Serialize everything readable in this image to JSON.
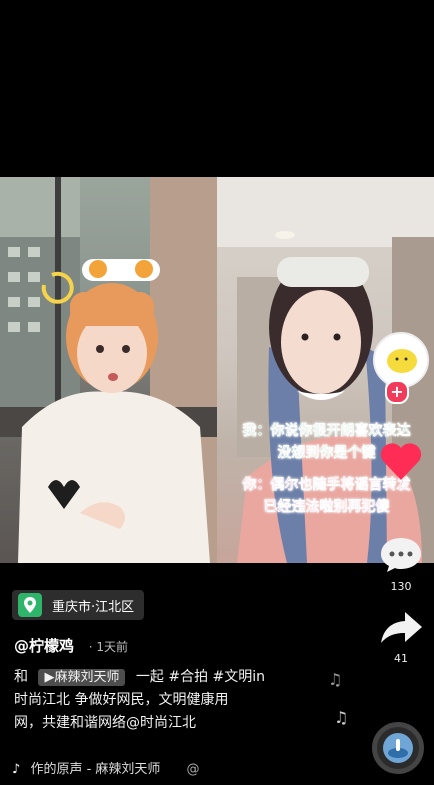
{
  "location": {
    "text": "重庆市·江北区"
  },
  "author": {
    "handle": "@柠檬鸡",
    "time": "· 1天前"
  },
  "caption": {
    "prefix": "和",
    "mention_user": "▶麻辣刘天师",
    "line1_rest": "一起 #合拍 #文明in",
    "line2": "时尚江北 争做好网民，文明健康用",
    "line3": "网，共建和谐网络@时尚江北"
  },
  "music": {
    "text": "作的原声 - 麻辣刘天师",
    "extra": "@"
  },
  "overlay": {
    "line1": "我：你说你很开朗喜欢表达",
    "line2": "没想到你是个键",
    "line3": "你：偶尔也随手将谣言转发",
    "line4": "已经违法啦别再犯傻"
  },
  "actions": {
    "comment_count": "130",
    "share_count": "41"
  },
  "colors": {
    "overlay_green": "#2aa56a",
    "overlay_pink": "#e0458e",
    "follow_red": "#f23a5a",
    "heart_red": "#ff2d55"
  }
}
